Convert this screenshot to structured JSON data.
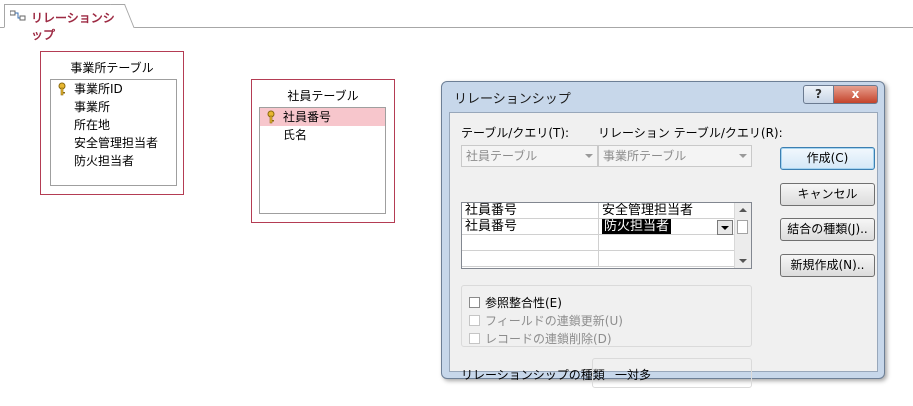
{
  "tab": {
    "label": "リレーションシップ",
    "icon": "relationships-icon"
  },
  "tables": [
    {
      "title": "事業所テーブル",
      "fields": [
        {
          "name": "事業所ID",
          "key": true
        },
        {
          "name": "事業所",
          "key": false
        },
        {
          "name": "所在地",
          "key": false
        },
        {
          "name": "安全管理担当者",
          "key": false
        },
        {
          "name": "防火担当者",
          "key": false
        }
      ]
    },
    {
      "title": "社員テーブル",
      "fields": [
        {
          "name": "社員番号",
          "key": true,
          "selected": true
        },
        {
          "name": "氏名",
          "key": false
        }
      ]
    }
  ],
  "dialog": {
    "title": "リレーションシップ",
    "help_label": "?",
    "close_label": "x",
    "table_query_label": "テーブル/クエリ(T):",
    "related_table_query_label": "リレーション テーブル/クエリ(R):",
    "table_query_value": "社員テーブル",
    "related_table_query_value": "事業所テーブル",
    "rows": [
      {
        "left": "社員番号",
        "right": "安全管理担当者"
      },
      {
        "left": "社員番号",
        "right": "防火担当者"
      }
    ],
    "integrity_label": "参照整合性(E)",
    "cascade_update_label": "フィールドの連鎖更新(U)",
    "cascade_delete_label": "レコードの連鎖削除(D)",
    "relationship_type_label": "リレーションシップの種類",
    "relationship_type_value": "一対多",
    "buttons": {
      "create": "作成(C)",
      "cancel": "キャンセル",
      "join_type": "結合の種類(J)..",
      "create_new": "新規作成(N).."
    }
  },
  "colors": {
    "table_border": "#b43c53",
    "selected_row": "#f7c6cc",
    "tab_text": "#9d2a43"
  }
}
